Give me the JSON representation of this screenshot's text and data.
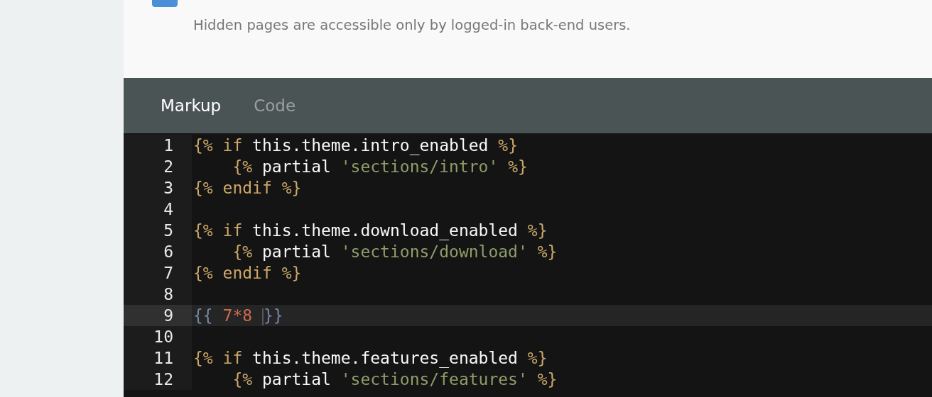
{
  "hidden_field": {
    "checked": true,
    "comment": "Hidden pages are accessible only by logged-in back-end users."
  },
  "editor_tabs": [
    {
      "label": "Markup",
      "selected": true
    },
    {
      "label": "Code",
      "selected": false
    }
  ],
  "code_lines": [
    {
      "number": "1",
      "active": false,
      "tokens": [
        {
          "text": "{% ",
          "kind": "tag"
        },
        {
          "text": "if ",
          "kind": "keyword"
        },
        {
          "text": "this.theme.intro_enabled ",
          "kind": "plain"
        },
        {
          "text": "%}",
          "kind": "tag"
        }
      ]
    },
    {
      "number": "2",
      "active": false,
      "tokens": [
        {
          "text": "    {% ",
          "kind": "tag"
        },
        {
          "text": "partial ",
          "kind": "plain"
        },
        {
          "text": "'sections/intro' ",
          "kind": "string"
        },
        {
          "text": "%}",
          "kind": "tag"
        }
      ]
    },
    {
      "number": "3",
      "active": false,
      "tokens": [
        {
          "text": "{% ",
          "kind": "tag"
        },
        {
          "text": "endif ",
          "kind": "keyword"
        },
        {
          "text": "%}",
          "kind": "tag"
        }
      ]
    },
    {
      "number": "4",
      "active": false
    },
    {
      "number": "5",
      "active": false,
      "tokens": [
        {
          "text": "{% ",
          "kind": "tag"
        },
        {
          "text": "if ",
          "kind": "keyword"
        },
        {
          "text": "this.theme.download_enabled ",
          "kind": "plain"
        },
        {
          "text": "%}",
          "kind": "tag"
        }
      ]
    },
    {
      "number": "6",
      "active": false,
      "tokens": [
        {
          "text": "    {% ",
          "kind": "tag"
        },
        {
          "text": "partial ",
          "kind": "plain"
        },
        {
          "text": "'sections/download' ",
          "kind": "string"
        },
        {
          "text": "%}",
          "kind": "tag"
        }
      ]
    },
    {
      "number": "7",
      "active": false,
      "tokens": [
        {
          "text": "{% ",
          "kind": "tag"
        },
        {
          "text": "endif ",
          "kind": "keyword"
        },
        {
          "text": "%}",
          "kind": "tag"
        }
      ]
    },
    {
      "number": "8",
      "active": false
    },
    {
      "number": "9",
      "active": true,
      "tokens": [
        {
          "text": "{{ ",
          "kind": "brace"
        },
        {
          "text": "7*8 ",
          "kind": "number"
        },
        {
          "kind": "cursor"
        },
        {
          "text": "}}",
          "kind": "brace"
        }
      ]
    },
    {
      "number": "10",
      "active": false
    },
    {
      "number": "11",
      "active": false,
      "tokens": [
        {
          "text": "{% ",
          "kind": "tag"
        },
        {
          "text": "if ",
          "kind": "keyword"
        },
        {
          "text": "this.theme.features_enabled ",
          "kind": "plain"
        },
        {
          "text": "%}",
          "kind": "tag"
        }
      ]
    },
    {
      "number": "12",
      "active": false,
      "tokens": [
        {
          "text": "    {% ",
          "kind": "tag"
        },
        {
          "text": "partial ",
          "kind": "plain"
        },
        {
          "text": "'sections/features' ",
          "kind": "string"
        },
        {
          "text": "%}",
          "kind": "tag"
        }
      ]
    }
  ]
}
